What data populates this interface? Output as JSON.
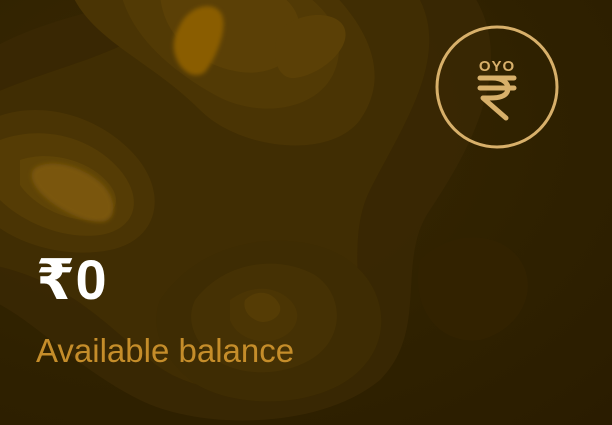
{
  "wallet": {
    "badge_brand": "OYO",
    "badge_icon": "rupee-icon",
    "amount": "₹0",
    "caption": "Available balance"
  },
  "colors": {
    "background": "#2f2000",
    "accent": "#c58d2a",
    "badge_ring": "#d8b06a",
    "amount_text": "#ffffff"
  }
}
